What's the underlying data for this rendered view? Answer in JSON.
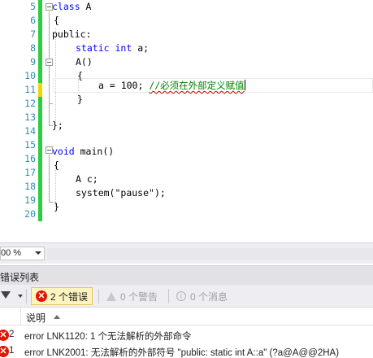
{
  "editor": {
    "lines": [
      {
        "n": "5"
      },
      {
        "n": "6"
      },
      {
        "n": "7"
      },
      {
        "n": "8"
      },
      {
        "n": "9"
      },
      {
        "n": "10"
      },
      {
        "n": "11"
      },
      {
        "n": "12"
      },
      {
        "n": "13"
      },
      {
        "n": "14"
      },
      {
        "n": "15"
      },
      {
        "n": "16"
      },
      {
        "n": "17"
      },
      {
        "n": "18"
      },
      {
        "n": "19"
      },
      {
        "n": "20"
      }
    ],
    "code": {
      "l5_kw": "class",
      "l5_rest": " A",
      "l6": "{",
      "l7": "public:",
      "l8_kw1": "static",
      "l8_kw2": "int",
      "l8_rest": " a;",
      "l9": "A()",
      "l10": "{",
      "l11_code": "a = 100; ",
      "l11_comment": "//必须在外部定义赋值",
      "l12": "}",
      "l14": "};",
      "l16_kw": "void",
      "l16_rest": " main()",
      "l17": "{",
      "l18": "A c;",
      "l19_fn": "system(",
      "l19_str": "\"pause\"",
      "l19_end": ");",
      "l20": "}"
    },
    "colors": {
      "keyword": "#0000ff",
      "comment": "#008000",
      "line_number": "#2b91af",
      "saved_change": "#2ecc40",
      "unsaved_change": "#f2d600"
    }
  },
  "zoom": {
    "value": "00 %"
  },
  "error_list": {
    "title": "错误列表",
    "errors_button": "2 个错误",
    "warnings_button": "0 个警告",
    "messages_button": "0 个消息",
    "column_description": "说明",
    "rows": [
      {
        "num": "2",
        "desc": "error LNK1120: 1 个无法解析的外部命令"
      },
      {
        "num": "1",
        "desc": "error LNK2001: 无法解析的外部符号 \"public: static int A::a\" (?a@A@@2HA)"
      }
    ]
  }
}
